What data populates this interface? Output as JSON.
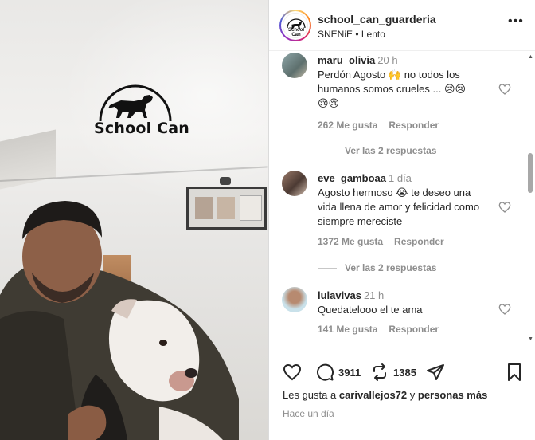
{
  "video": {
    "logo_text": "School Can"
  },
  "header": {
    "username": "school_can_guarderia",
    "subtitle": "SNENiE • Lento",
    "avatar_label": "School Can",
    "more_icon": "more-horizontal-icon"
  },
  "comments": [
    {
      "username": "maru_olivia",
      "time": "20 h",
      "text_lines": [
        "Perdón Agosto 🙌 no todos los",
        "humanos somos crueles ... 😢😢",
        "😢😢"
      ],
      "likes": "262 Me gusta",
      "reply": "Responder",
      "view_replies": "Ver las 2 respuestas"
    },
    {
      "username": "eve_gamboaa",
      "time": "1 día",
      "text_lines": [
        "Agosto hermoso 😭 te deseo una",
        "vida llena de amor y felicidad como",
        "siempre mereciste"
      ],
      "likes": "1372 Me gusta",
      "reply": "Responder",
      "view_replies": "Ver las 2 respuestas"
    },
    {
      "username": "lulavivas",
      "time": "21 h",
      "text_lines": [
        "Quedatelooo el te ama"
      ],
      "likes": "141 Me gusta",
      "reply": "Responder"
    }
  ],
  "actions": {
    "comment_count": "3911",
    "repost_count": "1385",
    "likes_prefix": "Les gusta a",
    "liked_by": "carivallejos72",
    "likes_join": "y",
    "likes_others": "personas más",
    "date": "Hace un día"
  },
  "colors": {
    "text_primary": "#262626",
    "text_secondary": "#8e8e8e",
    "border": "#dbdbdb"
  }
}
